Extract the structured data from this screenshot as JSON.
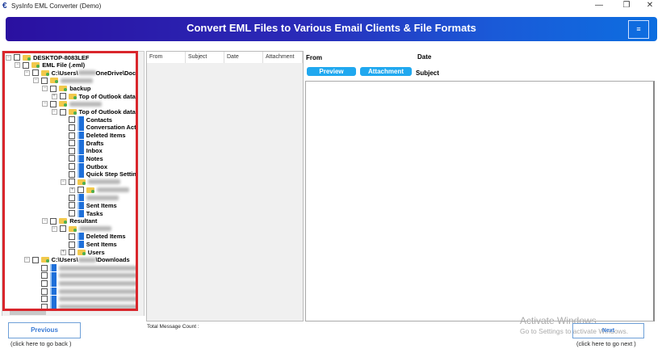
{
  "window": {
    "title": "SysInfo EML Converter (Demo)",
    "minimize": "—",
    "restore": "❐",
    "close": "✕"
  },
  "banner": {
    "title": "Convert EML Files to Various Email Clients & File Formats",
    "menu_icon": "≡"
  },
  "tree": {
    "rows": [
      {
        "label": "DESKTOP-8083LEF",
        "level": 0,
        "icon": "folder",
        "exp": "−"
      },
      {
        "label": "EML File (.eml)",
        "level": 1,
        "icon": "folder",
        "exp": "−"
      },
      {
        "label": "C:\\Users\\",
        "label2": "OneDrive\\Doc",
        "level": 2,
        "icon": "folder",
        "exp": "−",
        "redact": true
      },
      {
        "label": "",
        "level": 3,
        "icon": "folder",
        "exp": "−",
        "blur": true
      },
      {
        "label": "backup",
        "level": 4,
        "icon": "folder",
        "exp": "−"
      },
      {
        "label": "Top of Outlook data fi",
        "level": 5,
        "icon": "folder",
        "exp": "+"
      },
      {
        "label": "",
        "level": 4,
        "icon": "folder",
        "exp": "−",
        "blur": true
      },
      {
        "label": "Top of Outlook data fi",
        "level": 5,
        "icon": "folder",
        "exp": "−"
      },
      {
        "label": "Contacts",
        "level": 6,
        "icon": "file"
      },
      {
        "label": "Conversation Acti",
        "level": 6,
        "icon": "file"
      },
      {
        "label": "Deleted Items",
        "level": 6,
        "icon": "file"
      },
      {
        "label": "Drafts",
        "level": 6,
        "icon": "file"
      },
      {
        "label": "Inbox",
        "level": 6,
        "icon": "file"
      },
      {
        "label": "Notes",
        "level": 6,
        "icon": "file"
      },
      {
        "label": "Outbox",
        "level": 6,
        "icon": "file"
      },
      {
        "label": "Quick Step Setting",
        "level": 6,
        "icon": "file"
      },
      {
        "label": "",
        "level": 6,
        "icon": "folder",
        "exp": "−",
        "blur": true
      },
      {
        "label": "",
        "level": 7,
        "icon": "folder",
        "exp": "+",
        "blur": true
      },
      {
        "label": "",
        "level": 6,
        "icon": "file",
        "blur": true
      },
      {
        "label": "Sent Items",
        "level": 6,
        "icon": "file"
      },
      {
        "label": "Tasks",
        "level": 6,
        "icon": "file"
      },
      {
        "label": "Resultant",
        "level": 4,
        "icon": "folder",
        "exp": "−"
      },
      {
        "label": "",
        "level": 5,
        "icon": "folder",
        "exp": "−",
        "blur": true
      },
      {
        "label": "Deleted Items",
        "level": 6,
        "icon": "file"
      },
      {
        "label": "Sent Items",
        "level": 6,
        "icon": "file"
      },
      {
        "label": "Users",
        "level": 6,
        "icon": "folder",
        "exp": "+"
      },
      {
        "label": "C:\\Users\\",
        "label2": "\\Downloads",
        "level": 2,
        "icon": "folder",
        "exp": "−",
        "redact": true
      },
      {
        "label": "",
        "level": 3,
        "icon": "file",
        "blur": true
      },
      {
        "label": "",
        "level": 3,
        "icon": "file",
        "blur": true
      },
      {
        "label": "",
        "level": 3,
        "icon": "file",
        "blur": true
      },
      {
        "label": "",
        "level": 3,
        "icon": "file",
        "blur": true
      },
      {
        "label": "",
        "level": 3,
        "icon": "file",
        "blur": true
      },
      {
        "label": "",
        "level": 3,
        "icon": "file",
        "blur": true
      },
      {
        "label": "",
        "level": 3,
        "icon": "file",
        "blur": true
      }
    ]
  },
  "list": {
    "columns": [
      "From",
      "Subject",
      "Date",
      "Attachment"
    ],
    "total_label": "Total Message Count :"
  },
  "preview": {
    "from_label": "From",
    "date_label": "Date",
    "subject_label": "Subject",
    "preview_btn": "Preview",
    "attachment_btn": "Attachment"
  },
  "nav": {
    "previous": "Previous",
    "previous_hint": "(click here to  go back )",
    "next": "Next",
    "next_hint": "(click here to  go next )"
  },
  "watermark": {
    "line1": "Activate Windows",
    "line2": "Go to Settings to activate Windows."
  }
}
